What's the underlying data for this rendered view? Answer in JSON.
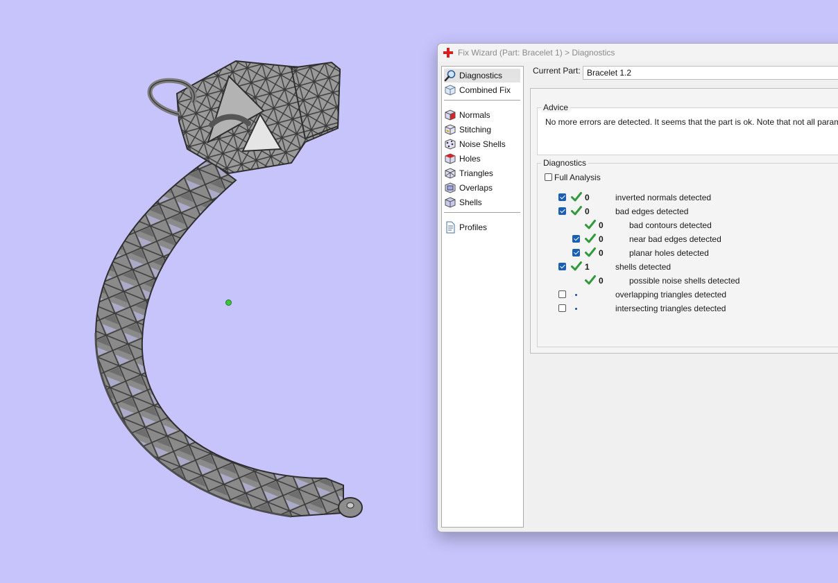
{
  "window": {
    "title": "Fix Wizard (Part: Bracelet 1) > Diagnostics"
  },
  "sidebar": {
    "groups": [
      [
        {
          "label": "Diagnostics",
          "icon": "magnifier-icon",
          "selected": true
        },
        {
          "label": "Combined Fix",
          "icon": "cube-icon",
          "selected": false
        }
      ],
      [
        {
          "label": "Normals",
          "icon": "normals-icon",
          "selected": false
        },
        {
          "label": "Stitching",
          "icon": "stitching-icon",
          "selected": false
        },
        {
          "label": "Noise Shells",
          "icon": "noise-shells-icon",
          "selected": false
        },
        {
          "label": "Holes",
          "icon": "holes-icon",
          "selected": false
        },
        {
          "label": "Triangles",
          "icon": "triangles-icon",
          "selected": false
        },
        {
          "label": "Overlaps",
          "icon": "overlaps-icon",
          "selected": false
        },
        {
          "label": "Shells",
          "icon": "shells-icon",
          "selected": false
        }
      ],
      [
        {
          "label": "Profiles",
          "icon": "document-icon",
          "selected": false
        }
      ]
    ]
  },
  "current_part": {
    "label": "Current Part:",
    "value": "Bracelet 1.2"
  },
  "advice": {
    "title": "Advice",
    "text": "No more errors are detected. It seems that the part is ok. Note that not all parameters w"
  },
  "diagnostics": {
    "title": "Diagnostics",
    "full_analysis": {
      "label": "Full Analysis",
      "checked": false
    },
    "rows": [
      {
        "checkbox": "on",
        "status": "ok",
        "count": "0",
        "label": "inverted normals detected",
        "indent": 0
      },
      {
        "checkbox": "on",
        "status": "ok",
        "count": "0",
        "label": "bad edges detected",
        "indent": 0
      },
      {
        "checkbox": "none",
        "status": "ok",
        "count": "0",
        "label": "bad contours detected",
        "indent": 1
      },
      {
        "checkbox": "on",
        "status": "ok",
        "count": "0",
        "label": "near bad edges detected",
        "indent": 1
      },
      {
        "checkbox": "on",
        "status": "ok",
        "count": "0",
        "label": "planar holes detected",
        "indent": 1
      },
      {
        "checkbox": "on",
        "status": "ok",
        "count": "1",
        "label": "shells detected",
        "indent": 0
      },
      {
        "checkbox": "none",
        "status": "ok",
        "count": "0",
        "label": "possible noise shells detected",
        "indent": 1
      },
      {
        "checkbox": "off",
        "status": "pending",
        "count": "",
        "label": "overlapping triangles detected",
        "indent": 0
      },
      {
        "checkbox": "off",
        "status": "pending",
        "count": "",
        "label": "intersecting triangles detected",
        "indent": 0
      }
    ]
  },
  "colors": {
    "viewport_background": "#c6c4fb",
    "checkmark_green": "#2e9a3a",
    "checkbox_blue": "#1a5fb4",
    "model_gray": "#7a7a7a"
  }
}
